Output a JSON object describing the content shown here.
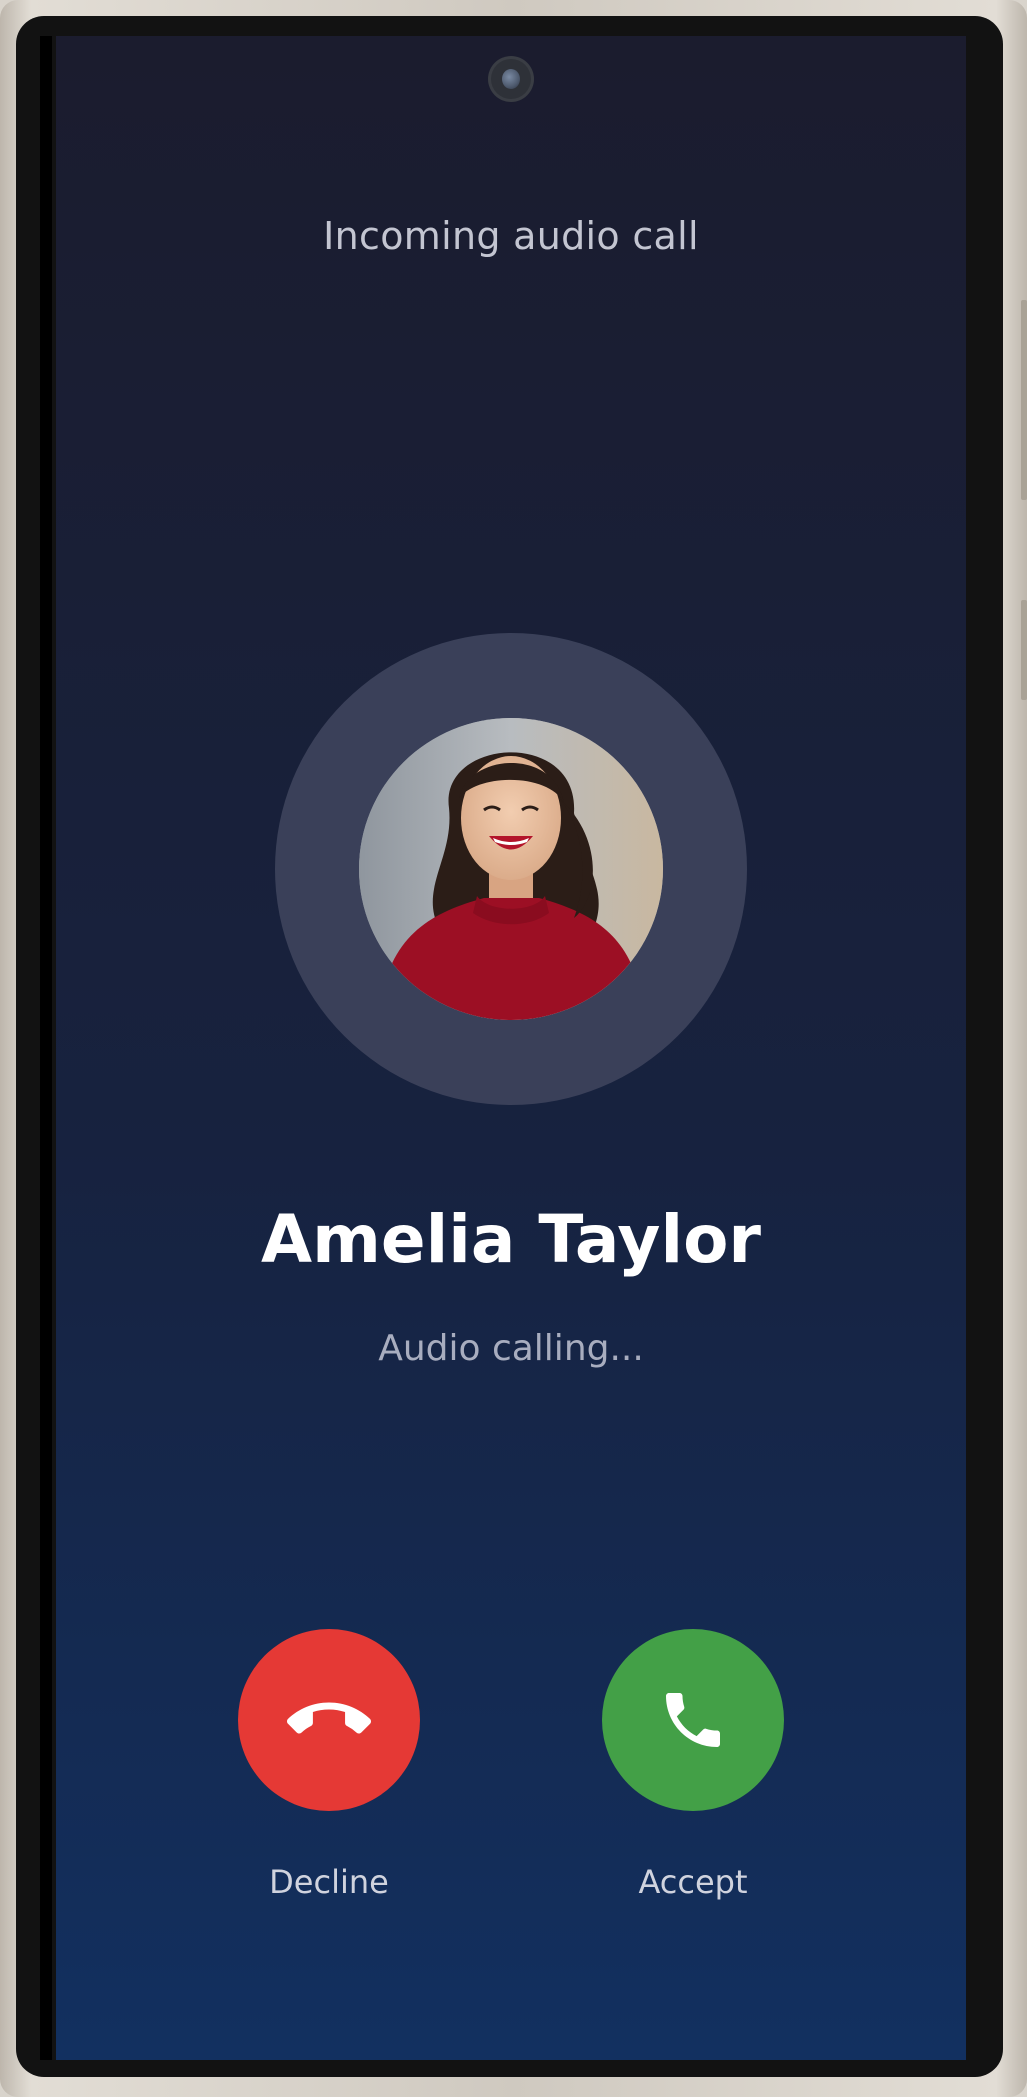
{
  "call": {
    "type_label": "Incoming audio call",
    "caller_name": "Amelia Taylor",
    "status": "Audio calling..."
  },
  "actions": {
    "decline_label": "Decline",
    "accept_label": "Accept"
  },
  "icons": {
    "decline": "phone-hangup-icon",
    "accept": "phone-icon"
  },
  "colors": {
    "decline": "#e53935",
    "accept": "#43a047",
    "background_top": "#1b1c2e",
    "background_bottom": "#123060",
    "avatar_ring": "#3a4059"
  }
}
